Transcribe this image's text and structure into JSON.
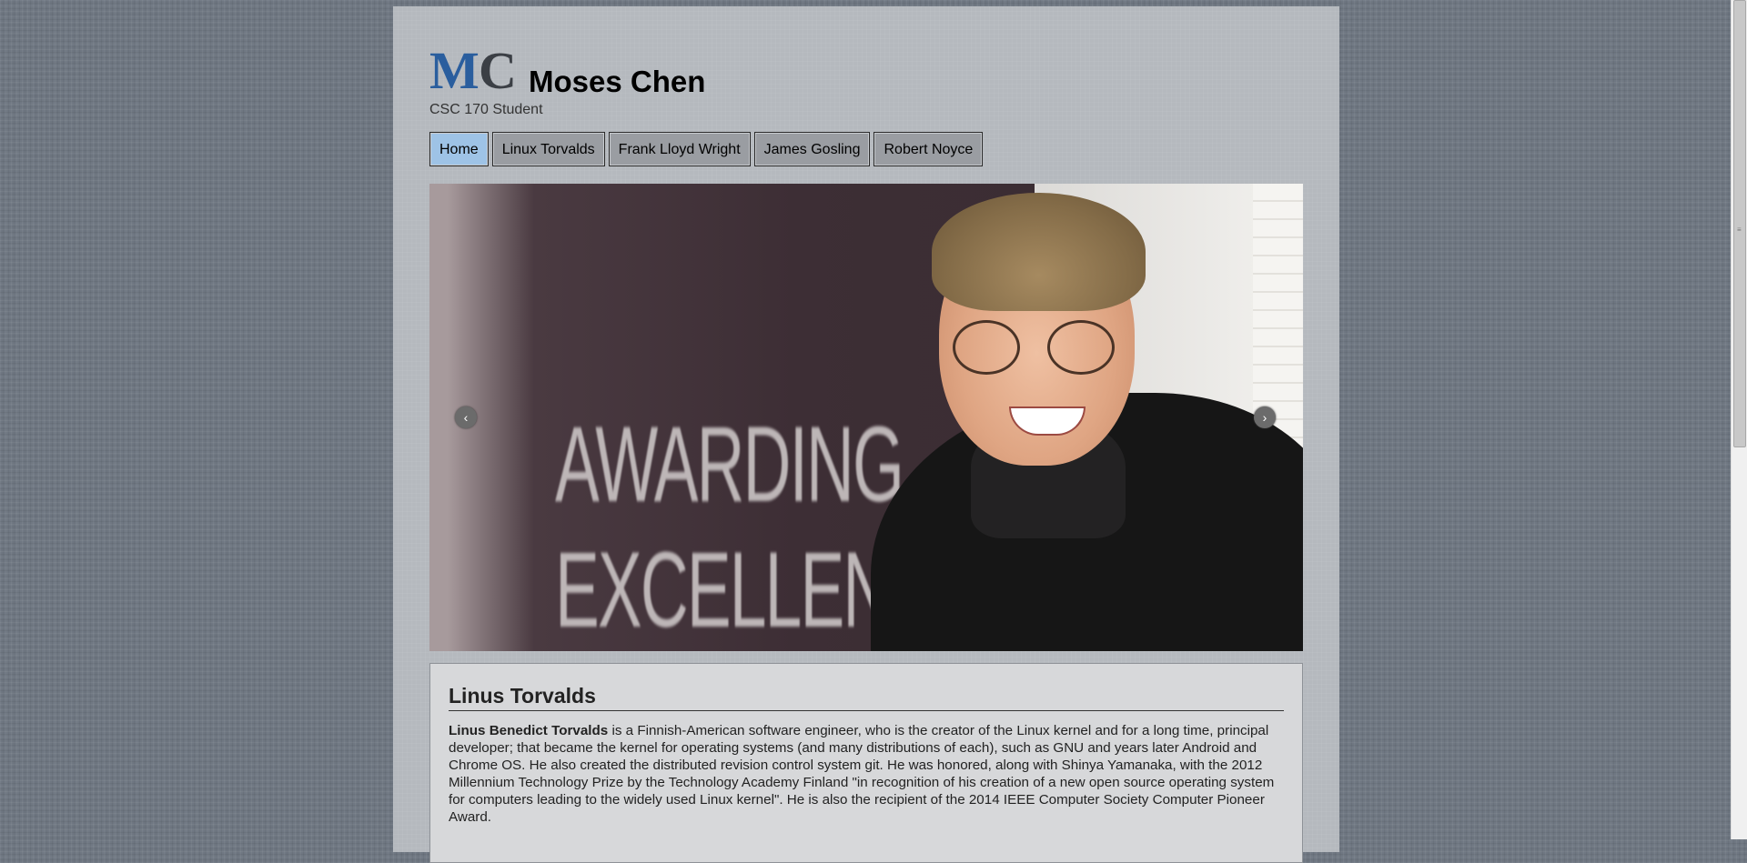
{
  "header": {
    "logo_m": "M",
    "logo_c": "C",
    "site_name": "Moses Chen",
    "subtitle": "CSC 170 Student"
  },
  "nav": {
    "items": [
      {
        "label": "Home",
        "active": true
      },
      {
        "label": "Linux Torvalds",
        "active": false
      },
      {
        "label": "Frank Lloyd Wright",
        "active": false
      },
      {
        "label": "James Gosling",
        "active": false
      },
      {
        "label": "Robert Noyce",
        "active": false
      }
    ]
  },
  "slider": {
    "banner_line1": "AWARDING",
    "banner_line2": "EXCELLENC",
    "prev_icon": "‹",
    "next_icon": "›"
  },
  "article": {
    "title": "Linus Torvalds",
    "name_bold": "Linus Benedict Torvalds",
    "body": " is a Finnish-American software engineer, who is the creator of the Linux kernel and for a long time, principal developer; that became the kernel for operating systems (and many distributions of each), such as GNU and years later Android and Chrome OS. He also created the distributed revision control system git. He was honored, along with Shinya Yamanaka, with the 2012 Millennium Technology Prize by the Technology Academy Finland \"in recognition of his creation of a new open source operating system for computers leading to the widely used Linux kernel\". He is also the recipient of the 2014 IEEE Computer Society Computer Pioneer Award."
  },
  "colors": {
    "logo_m": "#2a5e9e",
    "nav_active": "#9ec3e6",
    "nav_default": "#9a9da2"
  }
}
